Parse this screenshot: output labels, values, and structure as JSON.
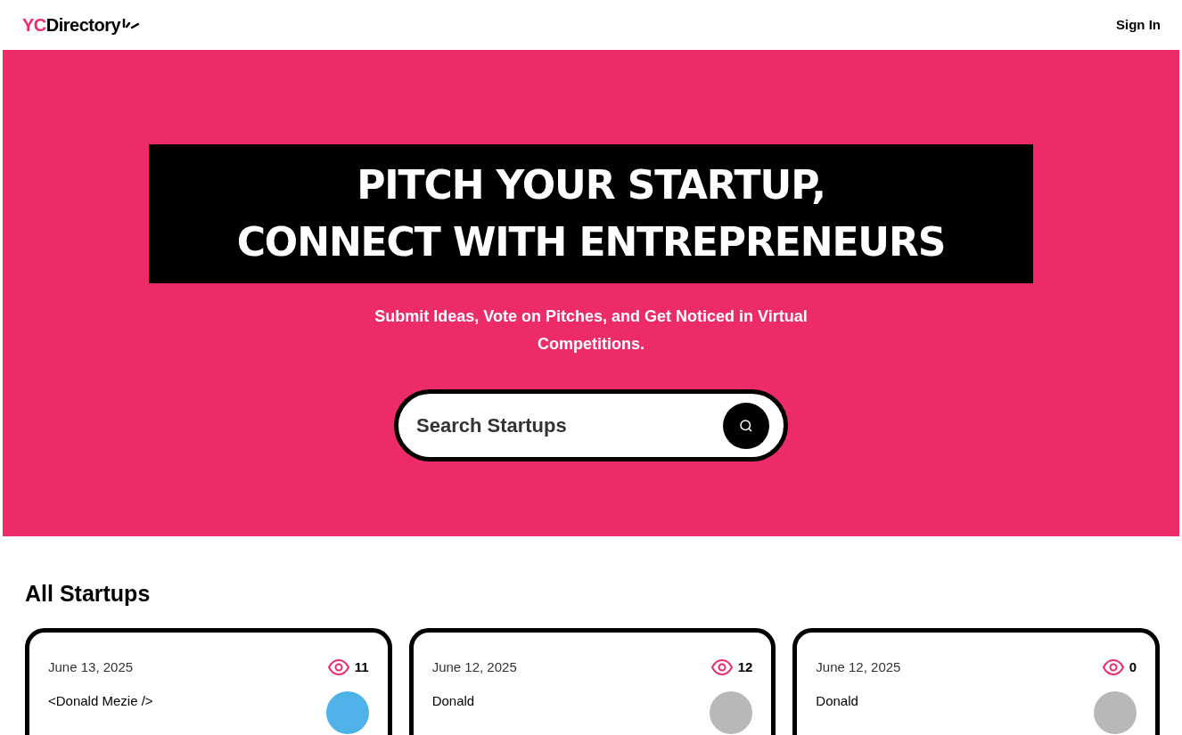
{
  "header": {
    "logo": {
      "accent": "YC",
      "rest": "Directory"
    },
    "sign_in": "Sign In"
  },
  "hero": {
    "title_lines": [
      "PITCH YOUR STARTUP,",
      "CONNECT WITH ENTREPRENEURS"
    ],
    "subtitle": "Submit Ideas, Vote on Pitches, and Get Noticed in Virtual Competitions.",
    "search": {
      "placeholder": "Search Startups"
    }
  },
  "section_title": "All Startups",
  "cards": [
    {
      "date": "June 13, 2025",
      "views": "11",
      "author": "<Donald Mezie />",
      "avatar": {
        "kind": "cartoon"
      }
    },
    {
      "date": "June 12, 2025",
      "views": "12",
      "author": "Donald",
      "avatar": {
        "kind": "photo"
      }
    },
    {
      "date": "June 12, 2025",
      "views": "0",
      "author": "Donald",
      "avatar": {
        "kind": "photo"
      }
    }
  ]
}
